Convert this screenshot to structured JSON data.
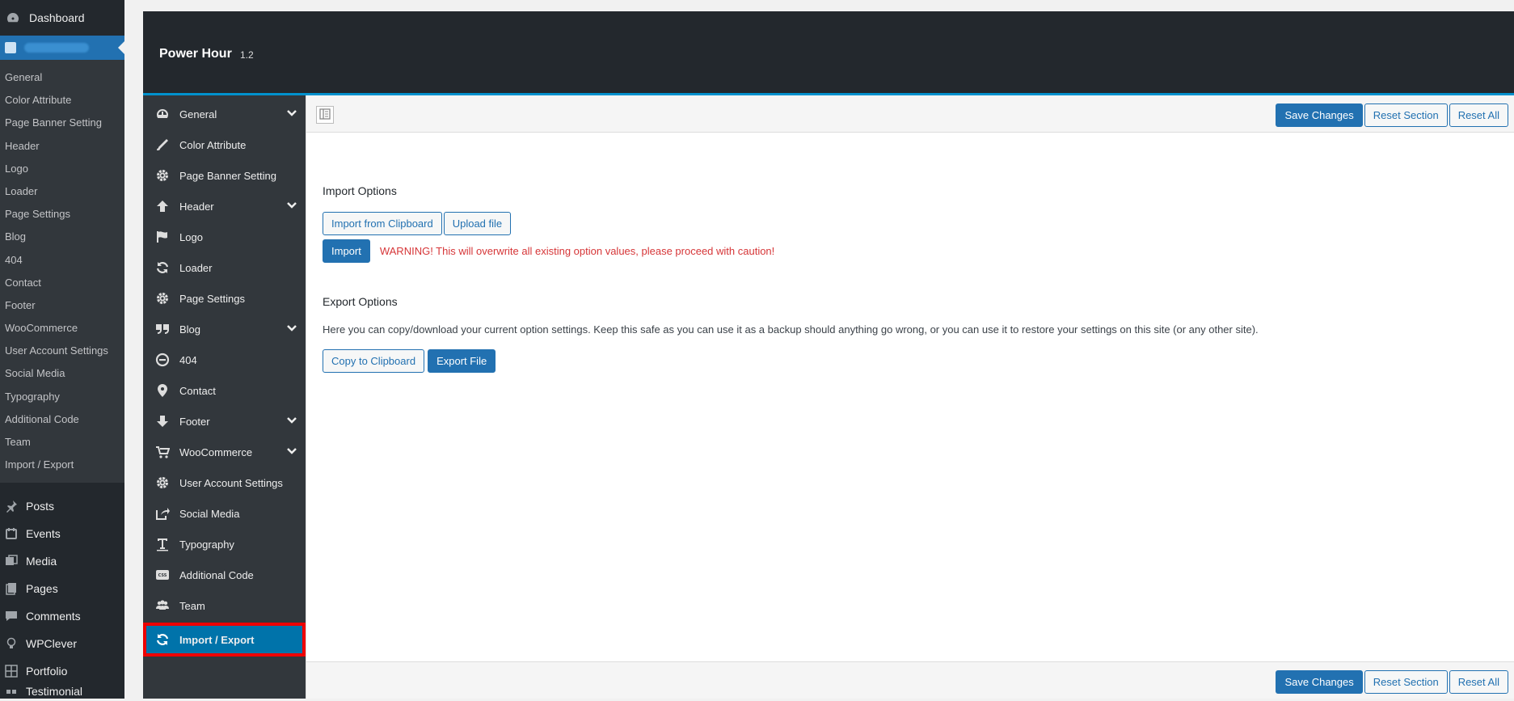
{
  "wp_menu": {
    "dashboard": "Dashboard",
    "sub_items": [
      "General",
      "Color Attribute",
      "Page Banner Setting",
      "Header",
      "Logo",
      "Loader",
      "Page Settings",
      "Blog",
      "404",
      "Contact",
      "Footer",
      "WooCommerce",
      "User Account Settings",
      "Social Media",
      "Typography",
      "Additional Code",
      "Team",
      "Import / Export"
    ],
    "main_items": [
      "Posts",
      "Events",
      "Media",
      "Pages",
      "Comments",
      "WPClever",
      "Portfolio",
      "Testimonial"
    ]
  },
  "panel": {
    "title": "Power Hour",
    "version": "1.2"
  },
  "nav": [
    {
      "label": "General",
      "icon": "dashboard-icon",
      "has_children": true
    },
    {
      "label": "Color Attribute",
      "icon": "brush-icon",
      "has_children": false
    },
    {
      "label": "Page Banner Setting",
      "icon": "gear-icon",
      "has_children": false
    },
    {
      "label": "Header",
      "icon": "arrow-up-icon",
      "has_children": true
    },
    {
      "label": "Logo",
      "icon": "flag-icon",
      "has_children": false
    },
    {
      "label": "Loader",
      "icon": "refresh-icon",
      "has_children": false
    },
    {
      "label": "Page Settings",
      "icon": "gear-icon",
      "has_children": false
    },
    {
      "label": "Blog",
      "icon": "quote-icon",
      "has_children": true
    },
    {
      "label": "404",
      "icon": "minus-circle-icon",
      "has_children": false
    },
    {
      "label": "Contact",
      "icon": "map-marker-icon",
      "has_children": false
    },
    {
      "label": "Footer",
      "icon": "arrow-down-icon",
      "has_children": true
    },
    {
      "label": "WooCommerce",
      "icon": "cart-icon",
      "has_children": true
    },
    {
      "label": "User Account Settings",
      "icon": "gear-icon",
      "has_children": false
    },
    {
      "label": "Social Media",
      "icon": "share-icon",
      "has_children": false
    },
    {
      "label": "Typography",
      "icon": "text-icon",
      "has_children": false
    },
    {
      "label": "Additional Code",
      "icon": "css-icon",
      "has_children": false
    },
    {
      "label": "Team",
      "icon": "users-icon",
      "has_children": false
    },
    {
      "label": "Import / Export",
      "icon": "refresh-icon",
      "has_children": false,
      "active": true
    }
  ],
  "toolbar": {
    "save": "Save Changes",
    "reset_section": "Reset Section",
    "reset_all": "Reset All"
  },
  "import": {
    "title": "Import Options",
    "from_clipboard": "Import from Clipboard",
    "upload": "Upload file",
    "import": "Import",
    "warning": "WARNING! This will overwrite all existing option values, please proceed with caution!"
  },
  "export": {
    "title": "Export Options",
    "description": "Here you can copy/download your current option settings. Keep this safe as you can use it as a backup should anything go wrong, or you can use it to restore your settings on this site (or any other site).",
    "copy": "Copy to Clipboard",
    "file": "Export File"
  },
  "colors": {
    "accent": "#2271b1",
    "active_nav": "#0073aa",
    "highlight": "#e00000",
    "warning": "#d63638"
  }
}
